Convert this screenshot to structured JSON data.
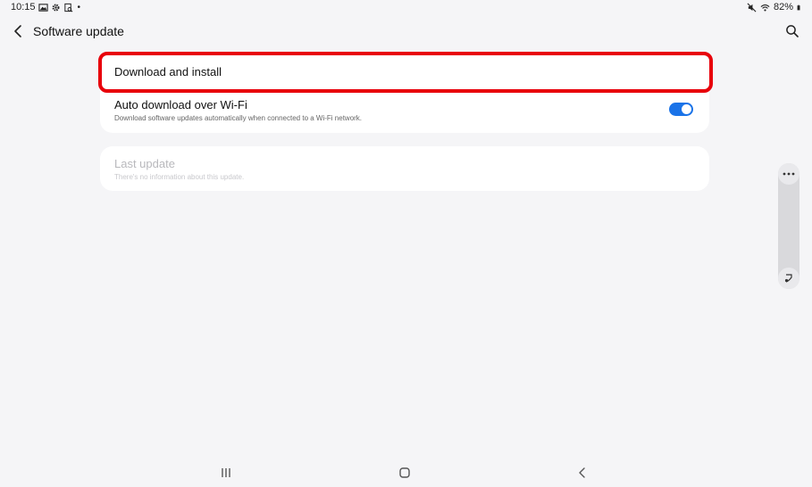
{
  "status_bar": {
    "time": "10:15",
    "dot": "•",
    "battery": "82%"
  },
  "header": {
    "title": "Software update"
  },
  "settings": {
    "download_install": {
      "label": "Download and install"
    },
    "auto_download": {
      "label": "Auto download over Wi-Fi",
      "description": "Download software updates automatically when connected to a Wi-Fi network.",
      "enabled": true
    },
    "last_update": {
      "label": "Last update",
      "description": "There's no information about this update."
    }
  },
  "colors": {
    "accent": "#1a73e8",
    "highlight": "#e8000b",
    "background": "#f5f5f7"
  },
  "icons": {
    "back": "chevron-left-icon",
    "search": "search-icon",
    "more": "more-horizontal-icon",
    "edge": "edge-panel-icon",
    "recents": "recents-icon",
    "home": "home-icon",
    "nav_back": "nav-back-icon"
  }
}
